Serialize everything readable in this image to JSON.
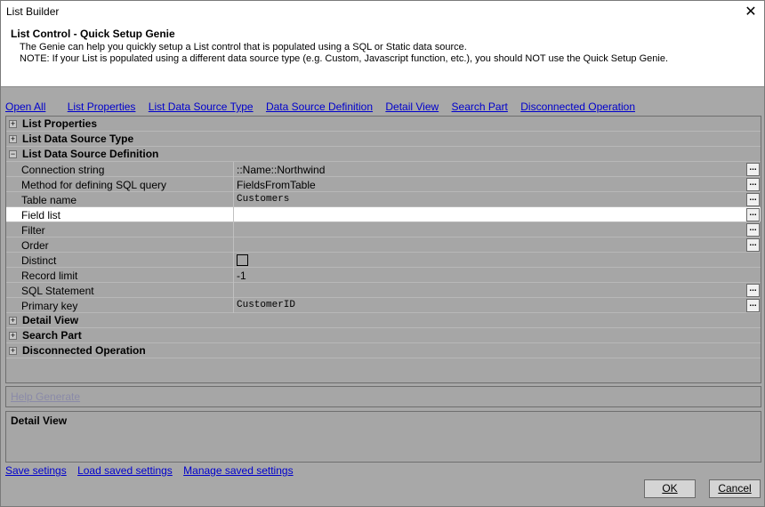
{
  "window": {
    "title": "List Builder"
  },
  "header": {
    "title": "List Control - Quick Setup Genie",
    "desc_line1": "The Genie can help you quickly setup a List control that is populated using a SQL or Static data source.",
    "desc_line2": "NOTE: If your List is populated using a different data source type (e.g. Custom, Javascript function, etc.), you should NOT use the Quick Setup Genie."
  },
  "nav": [
    "Open All",
    "List Properties",
    "List Data Source Type",
    "Data Source Definition",
    "Detail View",
    "Search Part",
    "Disconnected Operation"
  ],
  "grid": {
    "categories": {
      "list_properties": "List Properties",
      "list_data_source_type": "List Data Source Type",
      "list_data_source_definition": "List Data Source Definition",
      "detail_view": "Detail View",
      "search_part": "Search Part",
      "disconnected_operation": "Disconnected Operation"
    },
    "expander_collapsed": "+",
    "expander_expanded": "−",
    "props": [
      {
        "name": "Connection string",
        "value": "::Name::Northwind"
      },
      {
        "name": "Method for defining SQL query",
        "value": "FieldsFromTable"
      },
      {
        "name": "Table name",
        "value": "Customers"
      },
      {
        "name": "Field list",
        "value": ""
      },
      {
        "name": "Filter",
        "value": ""
      },
      {
        "name": "Order",
        "value": ""
      },
      {
        "name": "Distinct",
        "value": ""
      },
      {
        "name": "Record limit",
        "value": "-1"
      },
      {
        "name": "SQL Statement",
        "value": ""
      },
      {
        "name": "Primary key",
        "value": "CustomerID"
      }
    ],
    "ellipsis": "..."
  },
  "help_generate": "Help Generate",
  "detail_panel": {
    "title": "Detail View"
  },
  "bottom_links": [
    "Save setings",
    "Load saved settings",
    "Manage saved settings"
  ],
  "buttons": {
    "ok_label": "OK",
    "cancel_label": "Cancel"
  },
  "icons": {
    "close": "close-icon",
    "expander": "tree-expander-icon",
    "ellipsis": "ellipsis-icon"
  }
}
